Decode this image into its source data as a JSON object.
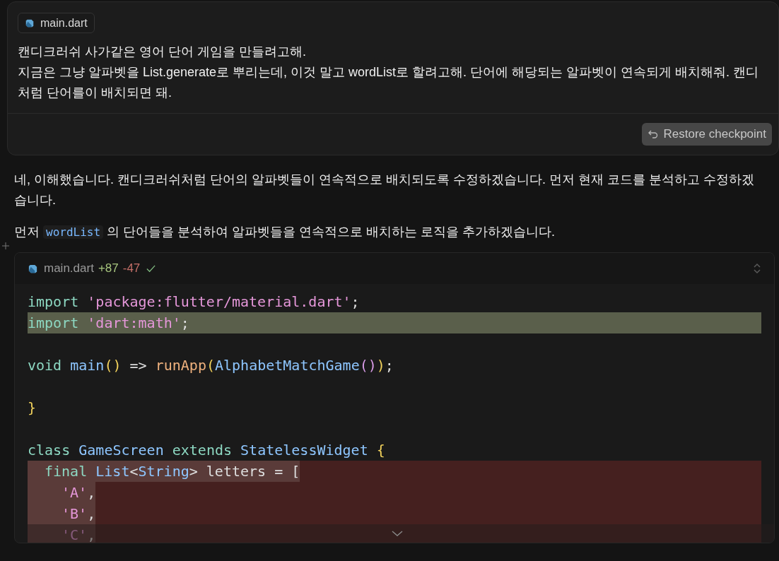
{
  "user_message": {
    "file_chip": "main.dart",
    "paragraphs": [
      "캔디크러쉬 사가같은 영어 단어 게임을 만들려고해.",
      "지금은 그냥 알파벳을 List.generate로 뿌리는데, 이것 말고 wordList로 할려고해. 단어에 해당되는 알파벳이 연속되게 배치해줘. 캔디처럼 단어를이 배치되면 돼."
    ],
    "restore_button": "Restore checkpoint"
  },
  "response": {
    "paragraphs": [
      [
        {
          "kind": "text",
          "s": "네, 이해했습니다. 캔디크러쉬처럼 단어의 알파벳들이 연속적으로 배치되도록 수정하겠습니다. 먼저 현재 코드를 분석하고 수정하겠습니다."
        }
      ],
      [
        {
          "kind": "text",
          "s": "먼저"
        },
        {
          "kind": "code",
          "s": "wordList"
        },
        {
          "kind": "text",
          "s": "의 단어들을 분석하여 알파벳들을 연속적으로 배치하는 로직을 추가하겠습니다."
        }
      ]
    ]
  },
  "code_block": {
    "file": "main.dart",
    "added": "+87",
    "removed": "-47",
    "applied": true,
    "lines": [
      {
        "kind": "normal",
        "tokens": [
          {
            "kind": "keyword",
            "s": "import"
          },
          {
            "kind": "string",
            "s": "'package:flutter/material.dart'"
          },
          {
            "kind": "plain",
            "s": ";"
          }
        ]
      },
      {
        "kind": "added",
        "tokens": [
          {
            "kind": "keyword",
            "s": "import"
          },
          {
            "kind": "string",
            "s": "'dart:math'"
          },
          {
            "kind": "plain",
            "s": ";"
          }
        ]
      },
      {
        "kind": "blank"
      },
      {
        "kind": "normal",
        "tokens": [
          {
            "kind": "keyword",
            "s": "void"
          },
          {
            "kind": "type",
            "s": "main"
          },
          {
            "kind": "paren",
            "s": "()"
          },
          {
            "kind": "plain",
            "s": "=>"
          },
          {
            "kind": "function",
            "s": "runApp"
          },
          {
            "kind": "paren",
            "s": "("
          },
          {
            "kind": "type",
            "s": "AlphabetMatchGame"
          },
          {
            "kind": "paren2",
            "s": "()"
          },
          {
            "kind": "paren",
            "s": ")"
          },
          {
            "kind": "plain",
            "s": ";"
          }
        ]
      },
      {
        "kind": "blank"
      },
      {
        "kind": "normal",
        "tokens": [
          {
            "kind": "paren",
            "s": "}"
          }
        ]
      },
      {
        "kind": "blank"
      },
      {
        "kind": "normal",
        "tokens": [
          {
            "kind": "keyword",
            "s": "class"
          },
          {
            "kind": "type",
            "s": "GameScreen"
          },
          {
            "kind": "keyword",
            "s": "extends"
          },
          {
            "kind": "type",
            "s": "StatelessWidget"
          },
          {
            "kind": "paren",
            "s": "{"
          }
        ],
        "children": [
          {
            "kind": "removed",
            "tokens": [
              {
                "kind": "keyword",
                "s": "final"
              },
              {
                "kind": "type",
                "s": "List"
              },
              {
                "kind": "plain",
                "s": "<"
              },
              {
                "kind": "type",
                "s": "String"
              },
              {
                "kind": "plain",
                "s": ">"
              },
              {
                "kind": "plain",
                "s": "letters"
              },
              {
                "kind": "plain",
                "s": "="
              },
              {
                "kind": "plain",
                "s": "["
              }
            ],
            "children": [
              {
                "kind": "removed",
                "tokens": [
                  {
                    "kind": "string",
                    "s": "'A'"
                  },
                  {
                    "kind": "plain",
                    "s": ","
                  }
                ]
              },
              {
                "kind": "removed",
                "tokens": [
                  {
                    "kind": "string",
                    "s": "'B'"
                  },
                  {
                    "kind": "plain",
                    "s": ","
                  }
                ]
              },
              {
                "kind": "removed",
                "tokens": [
                  {
                    "kind": "string",
                    "s": "'C'"
                  },
                  {
                    "kind": "plain",
                    "s": ","
                  }
                ]
              }
            ]
          }
        ]
      }
    ]
  }
}
